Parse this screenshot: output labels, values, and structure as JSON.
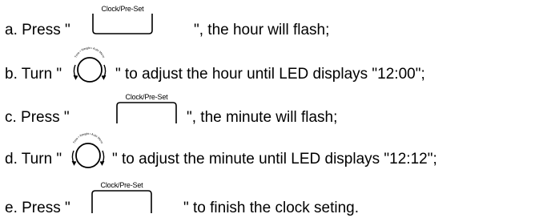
{
  "button_caption": "Clock/Pre-Set",
  "knob_label": "Time • Weight • Auto Menu",
  "steps": [
    {
      "before": "a. Press \"",
      "control": "button",
      "after": "\", the hour will flash;"
    },
    {
      "before": "b. Turn \"",
      "control": "knob",
      "after": "\" to adjust the hour until LED displays \"12:00\";"
    },
    {
      "before": "c. Press \"",
      "control": "button",
      "after": "\", the minute will flash;"
    },
    {
      "before": "d. Turn \"",
      "control": "knob",
      "after": "\" to adjust the minute until LED displays \"12:12\";"
    },
    {
      "before": "e. Press \"",
      "control": "button",
      "after": "\" to finish the clock seting."
    }
  ]
}
